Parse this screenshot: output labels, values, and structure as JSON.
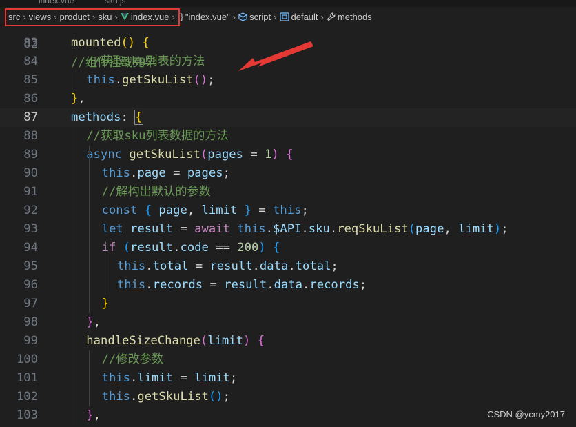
{
  "tabs_partial": [
    "index.vue",
    "sku.js"
  ],
  "breadcrumb": {
    "items": [
      {
        "label": "src",
        "icon": ""
      },
      {
        "label": "views",
        "icon": ""
      },
      {
        "label": "product",
        "icon": ""
      },
      {
        "label": "sku",
        "icon": ""
      },
      {
        "label": "index.vue",
        "icon": "vue-icon"
      },
      {
        "label": "\"index.vue\"",
        "icon": "brace-icon"
      },
      {
        "label": "script",
        "icon": "cube-icon"
      },
      {
        "label": "default",
        "icon": "bracket-object-icon"
      },
      {
        "label": "methods",
        "icon": "wrench-icon"
      }
    ],
    "brace_glyph": "{}"
  },
  "editor": {
    "active_line": 87,
    "partial_top_comment": "//组件挂载完毕",
    "lines": [
      {
        "n": "83",
        "tokens": [
          [
            "fn",
            "mounted"
          ],
          [
            "b1",
            "("
          ],
          [
            "b1",
            ")"
          ],
          [
            "op",
            " "
          ],
          [
            "b1",
            "{"
          ]
        ]
      },
      {
        "n": "84",
        "tokens": [
          [
            "cmt",
            "//获取sku列表的方法"
          ]
        ]
      },
      {
        "n": "85",
        "tokens": [
          [
            "kw",
            "this"
          ],
          [
            "op",
            "."
          ],
          [
            "fn",
            "getSkuList"
          ],
          [
            "b2",
            "("
          ],
          [
            "b2",
            ")"
          ],
          [
            "op",
            ";"
          ]
        ]
      },
      {
        "n": "86",
        "tokens": [
          [
            "b1",
            "}"
          ],
          [
            "op",
            ","
          ]
        ]
      },
      {
        "n": "87",
        "tokens": [
          [
            "var",
            "methods"
          ],
          [
            "op",
            ": "
          ],
          [
            "b1",
            "{"
          ]
        ]
      },
      {
        "n": "88",
        "tokens": [
          [
            "cmt",
            "//获取sku列表数据的方法"
          ]
        ]
      },
      {
        "n": "89",
        "tokens": [
          [
            "kw",
            "async"
          ],
          [
            "op",
            " "
          ],
          [
            "fn",
            "getSkuList"
          ],
          [
            "b2",
            "("
          ],
          [
            "var",
            "pages"
          ],
          [
            "op",
            " = "
          ],
          [
            "num",
            "1"
          ],
          [
            "b2",
            ")"
          ],
          [
            "op",
            " "
          ],
          [
            "b2",
            "{"
          ]
        ]
      },
      {
        "n": "90",
        "tokens": [
          [
            "kw",
            "this"
          ],
          [
            "op",
            "."
          ],
          [
            "var",
            "page"
          ],
          [
            "op",
            " = "
          ],
          [
            "var",
            "pages"
          ],
          [
            "op",
            ";"
          ]
        ]
      },
      {
        "n": "91",
        "tokens": [
          [
            "cmt",
            "//解构出默认的参数"
          ]
        ]
      },
      {
        "n": "92",
        "tokens": [
          [
            "kw",
            "const"
          ],
          [
            "op",
            " "
          ],
          [
            "b3",
            "{"
          ],
          [
            "op",
            " "
          ],
          [
            "var",
            "page"
          ],
          [
            "op",
            ", "
          ],
          [
            "var",
            "limit"
          ],
          [
            "op",
            " "
          ],
          [
            "b3",
            "}"
          ],
          [
            "op",
            " = "
          ],
          [
            "kw",
            "this"
          ],
          [
            "op",
            ";"
          ]
        ]
      },
      {
        "n": "93",
        "tokens": [
          [
            "kw",
            "let"
          ],
          [
            "op",
            " "
          ],
          [
            "var",
            "result"
          ],
          [
            "op",
            " = "
          ],
          [
            "ctl",
            "await"
          ],
          [
            "op",
            " "
          ],
          [
            "kw",
            "this"
          ],
          [
            "op",
            "."
          ],
          [
            "var",
            "$API"
          ],
          [
            "op",
            "."
          ],
          [
            "var",
            "sku"
          ],
          [
            "op",
            "."
          ],
          [
            "fn",
            "reqSkuList"
          ],
          [
            "b3",
            "("
          ],
          [
            "var",
            "page"
          ],
          [
            "op",
            ", "
          ],
          [
            "var",
            "limit"
          ],
          [
            "b3",
            ")"
          ],
          [
            "op",
            ";"
          ]
        ]
      },
      {
        "n": "94",
        "tokens": [
          [
            "ctl",
            "if"
          ],
          [
            "op",
            " "
          ],
          [
            "b3",
            "("
          ],
          [
            "var",
            "result"
          ],
          [
            "op",
            "."
          ],
          [
            "var",
            "code"
          ],
          [
            "op",
            " == "
          ],
          [
            "num",
            "200"
          ],
          [
            "b3",
            ")"
          ],
          [
            "op",
            " "
          ],
          [
            "b3",
            "{"
          ]
        ]
      },
      {
        "n": "95",
        "tokens": [
          [
            "kw",
            "this"
          ],
          [
            "op",
            "."
          ],
          [
            "var",
            "total"
          ],
          [
            "op",
            " = "
          ],
          [
            "var",
            "result"
          ],
          [
            "op",
            "."
          ],
          [
            "var",
            "data"
          ],
          [
            "op",
            "."
          ],
          [
            "var",
            "total"
          ],
          [
            "op",
            ";"
          ]
        ]
      },
      {
        "n": "96",
        "tokens": [
          [
            "kw",
            "this"
          ],
          [
            "op",
            "."
          ],
          [
            "var",
            "records"
          ],
          [
            "op",
            " = "
          ],
          [
            "var",
            "result"
          ],
          [
            "op",
            "."
          ],
          [
            "var",
            "data"
          ],
          [
            "op",
            "."
          ],
          [
            "var",
            "records"
          ],
          [
            "op",
            ";"
          ]
        ]
      },
      {
        "n": "97",
        "tokens": [
          [
            "b1",
            "}"
          ]
        ]
      },
      {
        "n": "98",
        "tokens": [
          [
            "b2",
            "}"
          ],
          [
            "op",
            ","
          ]
        ]
      },
      {
        "n": "99",
        "tokens": [
          [
            "fn",
            "handleSizeChange"
          ],
          [
            "b2",
            "("
          ],
          [
            "var",
            "limit"
          ],
          [
            "b2",
            ")"
          ],
          [
            "op",
            " "
          ],
          [
            "b2",
            "{"
          ]
        ]
      },
      {
        "n": "100",
        "tokens": [
          [
            "cmt",
            "//修改参数"
          ]
        ]
      },
      {
        "n": "101",
        "tokens": [
          [
            "kw",
            "this"
          ],
          [
            "op",
            "."
          ],
          [
            "var",
            "limit"
          ],
          [
            "op",
            " = "
          ],
          [
            "var",
            "limit"
          ],
          [
            "op",
            ";"
          ]
        ]
      },
      {
        "n": "102",
        "tokens": [
          [
            "kw",
            "this"
          ],
          [
            "op",
            "."
          ],
          [
            "fn",
            "getSkuList"
          ],
          [
            "b3",
            "("
          ],
          [
            "b3",
            ")"
          ],
          [
            "op",
            ";"
          ]
        ]
      },
      {
        "n": "103",
        "tokens": [
          [
            "b2",
            "}"
          ],
          [
            "op",
            ","
          ]
        ]
      }
    ]
  },
  "annotation": {
    "color": "#e53935"
  },
  "watermark": "CSDN @ycmy2017"
}
